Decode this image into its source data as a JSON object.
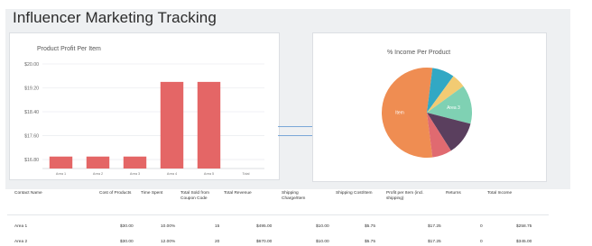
{
  "page": {
    "title": "Influencer Marketing Tracking"
  },
  "chart_data": [
    {
      "type": "bar",
      "title": "Product Profit Per Item",
      "categories": [
        "Area 1",
        "Area 2",
        "Area 3",
        "Area 4",
        "Area 5",
        "Total"
      ],
      "values": [
        16.9,
        16.9,
        16.9,
        19.4,
        19.4,
        null
      ],
      "ylim": [
        16.5,
        20.0
      ],
      "yticks": [
        "$20.00",
        "$19.20",
        "$18.40",
        "$17.60",
        "$16.80"
      ],
      "ytick_values": [
        20.0,
        19.2,
        18.4,
        17.6,
        16.8
      ],
      "color": "#e46666",
      "grid": true
    },
    {
      "type": "pie",
      "title": "% Income Per Product",
      "slices": [
        {
          "label": "Item",
          "value": 54,
          "color": "#ef8d52"
        },
        {
          "label": "",
          "value": 8,
          "color": "#32a8c4"
        },
        {
          "label": "",
          "value": 5,
          "color": "#f2cb73"
        },
        {
          "label": "Area 3",
          "value": 14,
          "color": "#7fd1b3"
        },
        {
          "label": "",
          "value": 12,
          "color": "#5a3f5e"
        },
        {
          "label": "",
          "value": 7,
          "color": "#e06a70"
        }
      ]
    }
  ],
  "table": {
    "headers": [
      "Contact Name",
      "Cost of Products",
      "Time Spent",
      "Total Sold from Coupon Code",
      "Total Revenue",
      "Shipping Charge/Item",
      "Shipping Cost/Item",
      "Profit per Item (incl. shipping)",
      "Returns",
      "Total Income"
    ],
    "rows": [
      [
        "Area 1",
        "$30.00",
        "10.00%",
        "15",
        "$495.00",
        "$10.00",
        "$5.75",
        "$17.25",
        "0",
        "$258.75"
      ],
      [
        "Area 2",
        "$30.00",
        "12.00%",
        "20",
        "$670.00",
        "$10.00",
        "$5.75",
        "$17.25",
        "0",
        "$345.00"
      ]
    ]
  }
}
